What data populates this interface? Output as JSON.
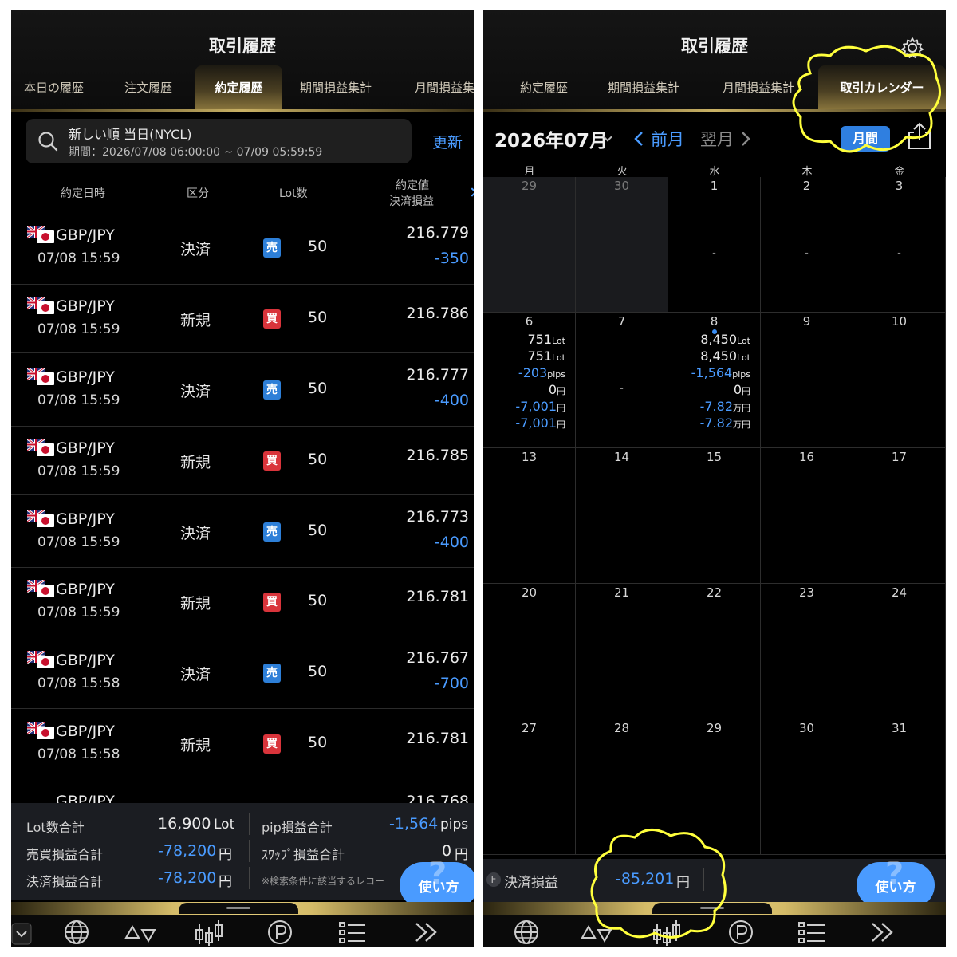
{
  "left": {
    "title": "取引履歴",
    "tabs": [
      "本日の履歴",
      "注文履歴",
      "約定履歴",
      "期間損益集計",
      "月間損益集"
    ],
    "search": {
      "line1": "新しい順 当日(NYCL)",
      "line2": "期間：2026/07/08 06:00:00 ~ 07/09 05:59:59",
      "refresh": "更新"
    },
    "columns": {
      "datetime": "約定日時",
      "kind": "区分",
      "lots": "Lot数",
      "price": "約定値",
      "pnl": "決済損益"
    },
    "rows": [
      {
        "pair": "GBP/JPY",
        "time": "07/08 15:59",
        "kind": "決済",
        "side": "売",
        "lots": "50",
        "price": "216.779",
        "pnl": "-350"
      },
      {
        "pair": "GBP/JPY",
        "time": "07/08 15:59",
        "kind": "新規",
        "side": "買",
        "lots": "50",
        "price": "216.786",
        "pnl": ""
      },
      {
        "pair": "GBP/JPY",
        "time": "07/08 15:59",
        "kind": "決済",
        "side": "売",
        "lots": "50",
        "price": "216.777",
        "pnl": "-400"
      },
      {
        "pair": "GBP/JPY",
        "time": "07/08 15:59",
        "kind": "新規",
        "side": "買",
        "lots": "50",
        "price": "216.785",
        "pnl": ""
      },
      {
        "pair": "GBP/JPY",
        "time": "07/08 15:59",
        "kind": "決済",
        "side": "売",
        "lots": "50",
        "price": "216.773",
        "pnl": "-400"
      },
      {
        "pair": "GBP/JPY",
        "time": "07/08 15:59",
        "kind": "新規",
        "side": "買",
        "lots": "50",
        "price": "216.781",
        "pnl": ""
      },
      {
        "pair": "GBP/JPY",
        "time": "07/08 15:58",
        "kind": "決済",
        "side": "売",
        "lots": "50",
        "price": "216.767",
        "pnl": "-700"
      },
      {
        "pair": "GBP/JPY",
        "time": "07/08 15:58",
        "kind": "新規",
        "side": "買",
        "lots": "50",
        "price": "216.781",
        "pnl": ""
      }
    ],
    "partial_row": {
      "pair": "GBP/JPY",
      "price": "216.768"
    },
    "summary": {
      "lot_total_label": "Lot数合計",
      "lot_total_value": "16,900",
      "lot_unit": "Lot",
      "pip_total_label": "pip損益合計",
      "pip_total_value": "-1,564",
      "pip_unit": "pips",
      "trade_pnl_label": "売買損益合計",
      "trade_pnl_value": "-78,200",
      "yen": "円",
      "swap_label": "ｽﾜｯﾌﾟ損益合計",
      "swap_value": "0",
      "settle_label": "決済損益合計",
      "settle_value": "-78,200",
      "note": "※検索条件に該当するレコー"
    },
    "help": {
      "q": "?",
      "label": "使い方"
    }
  },
  "right": {
    "title": "取引履歴",
    "tabs": [
      "約定履歴",
      "期間損益集計",
      "月間損益集計",
      "取引カレンダー"
    ],
    "month": "2026年07月",
    "prev": "前月",
    "next": "翌月",
    "view": "月間",
    "weekdays": [
      "月",
      "火",
      "水",
      "木",
      "金"
    ],
    "weeks": [
      [
        "29",
        "30",
        "1",
        "2",
        "3"
      ],
      [
        "6",
        "7",
        "8",
        "9",
        "10"
      ],
      [
        "13",
        "14",
        "15",
        "16",
        "17"
      ],
      [
        "20",
        "21",
        "22",
        "23",
        "24"
      ],
      [
        "27",
        "28",
        "29",
        "30",
        "31"
      ]
    ],
    "dash": "-",
    "day6": {
      "lot1": "751",
      "lot2": "751",
      "lot_unit": "Lot",
      "pips": "-203",
      "pips_unit": "pips",
      "swap": "0",
      "yen": "円",
      "pnl1": "-7,001",
      "pnl2": "-7,001"
    },
    "day8": {
      "lot1": "8,450",
      "lot2": "8,450",
      "lot_unit": "Lot",
      "pips": "-1,564",
      "pips_unit": "pips",
      "swap": "0",
      "yen": "円",
      "pnl1": "-7.82",
      "pnl2": "-7.82",
      "man_yen": "万円"
    },
    "footer": {
      "badge": "F",
      "label": "決済損益",
      "value": "-85,201",
      "unit": "円"
    },
    "help": {
      "q": "?",
      "label": "使い方"
    }
  },
  "colors": {
    "accent": "#4a9bff",
    "sell": "#2d7fd8",
    "buy": "#d9343b",
    "gold": "#d4bb68",
    "highlight": "#ffff3c"
  }
}
